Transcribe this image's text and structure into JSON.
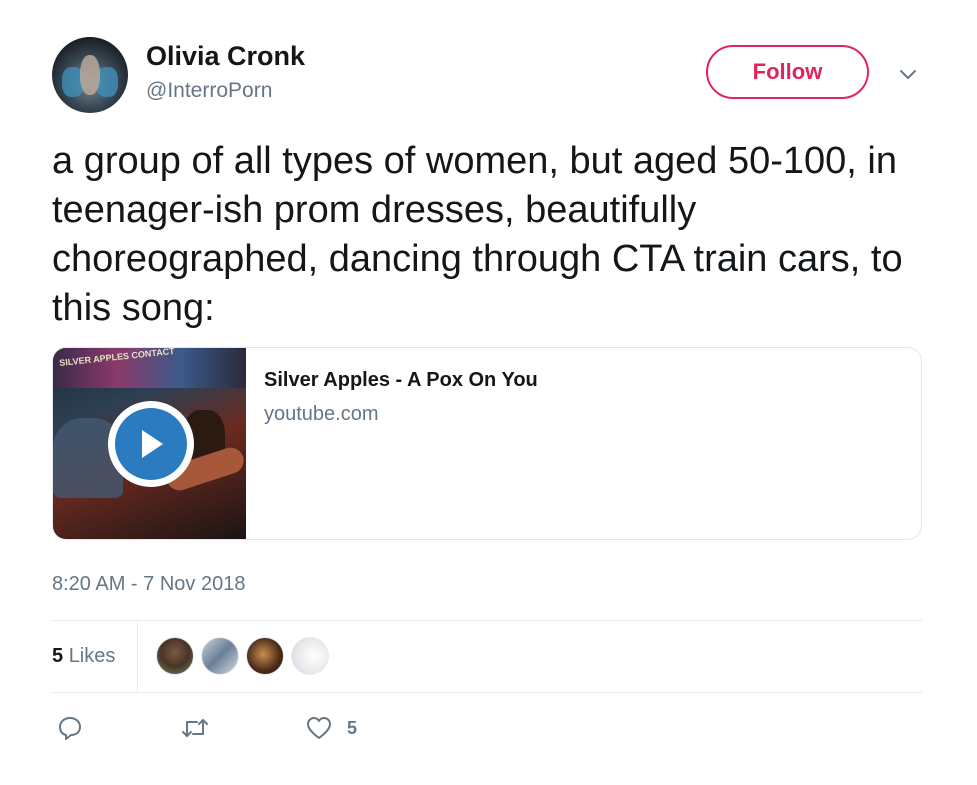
{
  "author": {
    "display_name": "Olivia Cronk",
    "handle": "@InterroPorn"
  },
  "follow_button": {
    "label": "Follow",
    "color": "#e0245e"
  },
  "tweet": {
    "text": "a group of all types of women, but aged 50-100, in teenager-ish prom dresses, beautifully choreographed, dancing through CTA train cars, to this song:"
  },
  "card": {
    "title": "Silver Apples - A Pox On You",
    "domain": "youtube.com",
    "thumb_label": "SILVER APPLES CONTACT"
  },
  "meta": {
    "timestamp": "8:20 AM - 7 Nov 2018"
  },
  "stats": {
    "likes_number": "5",
    "likes_word": "Likes"
  },
  "actions": {
    "reply_icon": "reply-icon",
    "retweet_icon": "retweet-icon",
    "like_icon": "heart-icon",
    "like_count": "5"
  }
}
